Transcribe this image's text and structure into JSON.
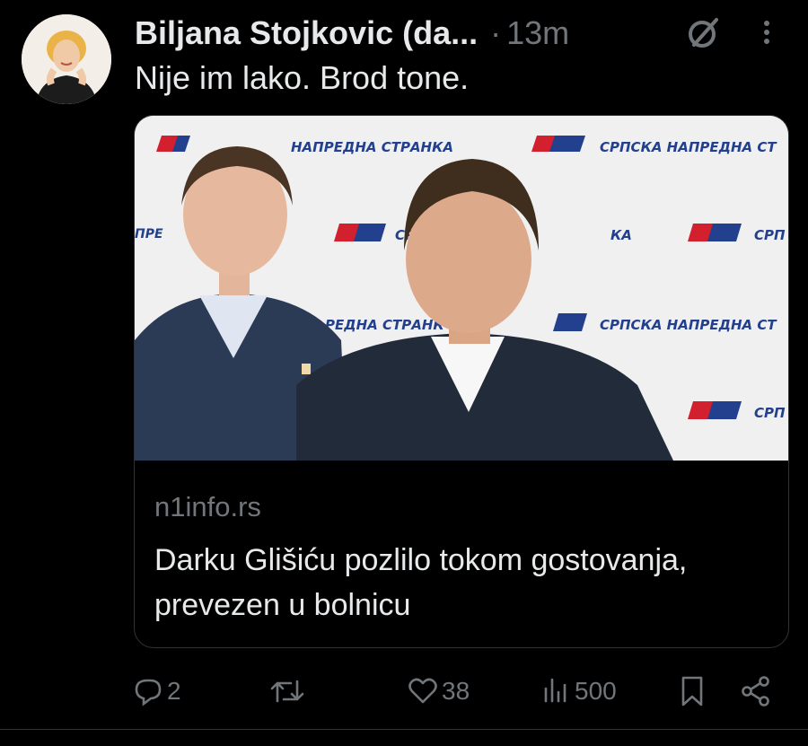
{
  "tweet": {
    "author_name": "Biljana Stojkovic (da...",
    "separator": "·",
    "timestamp": "13m",
    "text": "Nije im lako. Brod tone.",
    "card": {
      "image_banner_texts": [
        "НАПРЕДНА СТРАНКА",
        "СРПСКА НАПРЕДНА СТ",
        "ПРЕ",
        "СРПСК",
        "КА",
        "СРП",
        "РЕДНА СТРАНК",
        "СРПСКА НАПРЕДНА СТ",
        "СРП"
      ],
      "domain": "n1info.rs",
      "title": "Darku Glišiću pozlilo tokom gostovanja, prevezen u bolnicu"
    },
    "actions": {
      "replies": "2",
      "reposts": "",
      "likes": "38",
      "views": "500"
    }
  },
  "colors": {
    "background": "#000000",
    "text": "#e7e9ea",
    "muted": "#71767b",
    "border": "#2f3336",
    "sns_red": "#d3202f",
    "sns_blue": "#23408e"
  }
}
